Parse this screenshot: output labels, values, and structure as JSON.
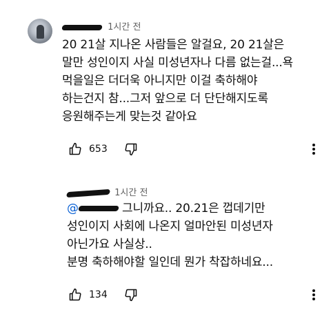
{
  "comments": [
    {
      "time": "1시간 전",
      "lines": [
        "20 21살 지나온 사람들은 알걸요, 20 21살은",
        "말만 성인이지 사실 미성년자나 다름 없는걸...욕",
        "먹을일은 더더욱 아니지만 이걸 축하해야",
        "하는건지 참...그저 앞으로 더 단단해지도록",
        "응원해주는게 맞는것 같아요"
      ],
      "likes": "653",
      "icons": {
        "like": "thumbs-up-icon",
        "dislike": "thumbs-down-icon",
        "menu": "more-vert-icon"
      }
    },
    {
      "time": "1시간 전",
      "mention_prefix": "@",
      "first_line_rest": "그니까요.. 20.21은 껍데기만",
      "lines": [
        "성인이지 사회에 나온지 얼마안된 미성년자",
        "아닌가요 사실상..",
        "분명 축하해야할 일인데 뭔가 착잡하네요..."
      ],
      "likes": "134",
      "icons": {
        "like": "thumbs-up-icon",
        "dislike": "thumbs-down-icon",
        "menu": "more-vert-icon"
      }
    }
  ],
  "colors": {
    "text": "#0f0f0f",
    "meta": "#606060",
    "mention": "#065fd4",
    "redaction": "#111111"
  }
}
